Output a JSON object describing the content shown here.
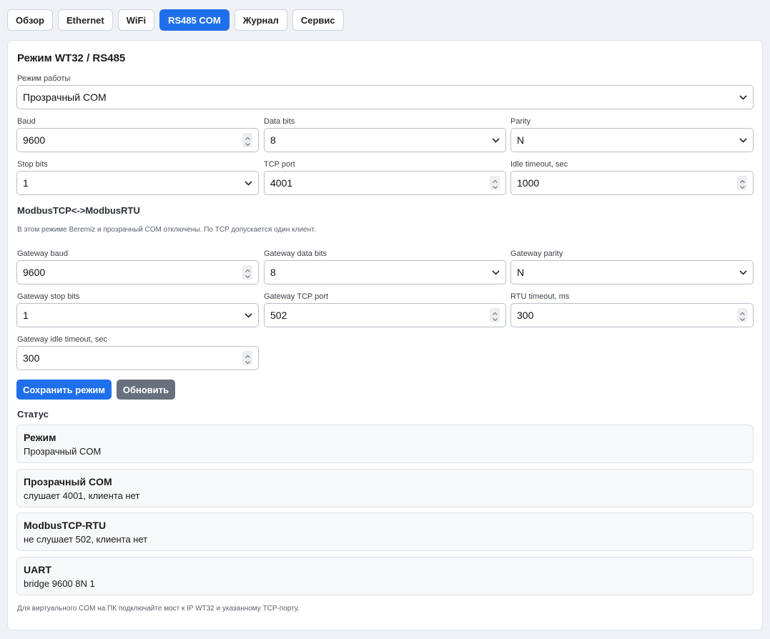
{
  "tabs": [
    "Обзор",
    "Ethernet",
    "WiFi",
    "RS485 COM",
    "Журнал",
    "Сервис"
  ],
  "active_tab": "RS485 COM",
  "panel": {
    "title": "Режим WT32 / RS485",
    "mode_label": "Режим работы",
    "mode_value": "Прозрачный COM"
  },
  "com": {
    "baud_label": "Baud",
    "baud_value": "9600",
    "data_bits_label": "Data bits",
    "data_bits_value": "8",
    "parity_label": "Parity",
    "parity_value": "N",
    "stop_bits_label": "Stop bits",
    "stop_bits_value": "1",
    "tcp_port_label": "TCP port",
    "tcp_port_value": "4001",
    "idle_label": "Idle timeout, sec",
    "idle_value": "1000"
  },
  "gateway": {
    "section_title": "ModbusTCP<->ModbusRTU",
    "note": "В этом режиме Beremiz и прозрачный COM отключены. По TCP допускается один клиент.",
    "baud_label": "Gateway baud",
    "baud_value": "9600",
    "data_bits_label": "Gateway data bits",
    "data_bits_value": "8",
    "parity_label": "Gateway parity",
    "parity_value": "N",
    "stop_bits_label": "Gateway stop bits",
    "stop_bits_value": "1",
    "tcp_port_label": "Gateway TCP port",
    "tcp_port_value": "502",
    "rtu_timeout_label": "RTU timeout, ms",
    "rtu_timeout_value": "300",
    "idle_label": "Gateway idle timeout, sec",
    "idle_value": "300"
  },
  "actions": {
    "save": "Сохранить режим",
    "refresh": "Обновить"
  },
  "status": {
    "title": "Статус",
    "cards": [
      {
        "title": "Режим",
        "value": "Прозрачный COM"
      },
      {
        "title": "Прозрачный COM",
        "value": "слушает 4001, клиента нет"
      },
      {
        "title": "ModbusTCP-RTU",
        "value": "не слушает 502, клиента нет"
      },
      {
        "title": "UART",
        "value": "bridge 9600 8N 1"
      }
    ],
    "footer": "Для виртуального COM на ПК подключайте мост к IP WT32 и указанному TCP-порту."
  },
  "colors": {
    "accent": "#1f6fea",
    "secondary": "#67707c"
  },
  "icons": {
    "select": "chevron-down-icon",
    "number": "spinner-icon"
  }
}
